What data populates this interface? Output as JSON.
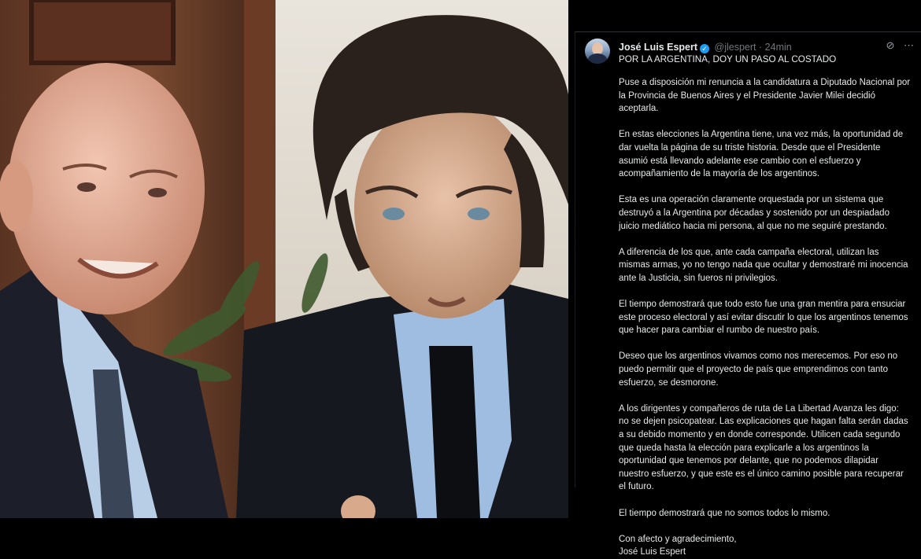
{
  "photo": {
    "alt": "photo"
  },
  "tweet": {
    "author_name": "José Luis Espert",
    "handle": "@jlespert",
    "separator": "·",
    "time": "24min",
    "headline": "POR LA ARGENTINA, DOY UN PASO AL COSTADO",
    "paragraphs": [
      "Puse a disposición mi renuncia a la candidatura a Diputado Nacional por la Provincia de Buenos Aires y el Presidente Javier Milei decidió aceptarla.",
      "En estas elecciones la Argentina tiene, una vez más, la oportunidad de dar vuelta la página de su triste historia. Desde que el Presidente asumió está llevando adelante ese cambio con el esfuerzo y acompañamiento de la mayoría de los argentinos.",
      "Esta es una operación claramente orquestada por un sistema que destruyó a la Argentina por décadas y sostenido por un despiadado juicio mediático hacia mi persona, al que no me seguiré prestando.",
      "A diferencia de los que, ante cada campaña electoral, utilizan las mismas armas, yo no tengo nada que ocultar y demostraré mi inocencia ante la Justicia, sin fueros ni privilegios.",
      "El tiempo demostrará que todo esto fue una gran mentira para ensuciar este proceso electoral y así evitar discutir lo que los argentinos tenemos que hacer para cambiar el rumbo de nuestro país.",
      "Deseo que los argentinos vivamos como nos merecemos. Por eso no puedo permitir que el proyecto de país que emprendimos con tanto esfuerzo, se desmorone.",
      "A los dirigentes y compañeros de ruta de La Libertad Avanza les digo: no se dejen psicopatear. Las explicaciones que hagan falta serán dadas a su debido momento y en donde corresponde. Utilicen cada segundo que queda hasta la elección para explicarle a los argentinos la oportunidad que tenemos por delante, que no podemos dilapidar nuestro esfuerzo, y que este es el único camino posible para recuperar el futuro.",
      "El tiempo demostrará que no somos todos lo mismo."
    ],
    "closing": "Con afecto y agradecimiento,",
    "signature": "José Luis Espert"
  },
  "icons": {
    "verified": "verified-badge-icon",
    "grok": "grok-icon",
    "more": "more-icon"
  },
  "colors": {
    "accent": "#1d9bf0",
    "text": "#e7e9ea",
    "muted": "#71767b",
    "background": "#000000"
  }
}
